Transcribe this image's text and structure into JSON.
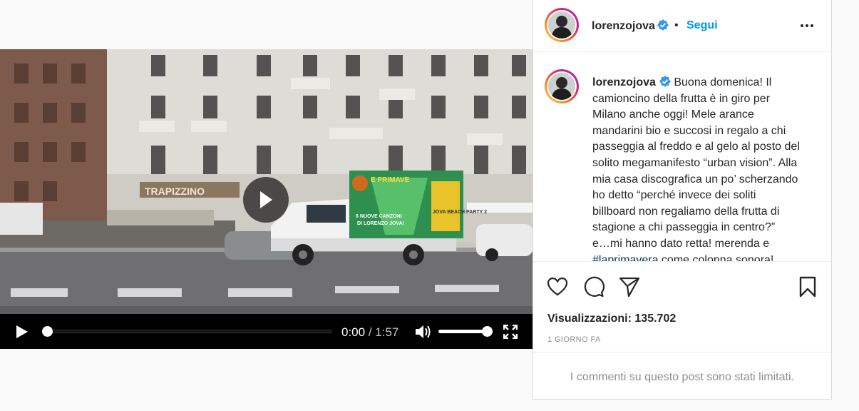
{
  "post": {
    "username": "lorenzojova",
    "follow_label": "Segui",
    "separator": "•",
    "caption_lines": [
      "Buona domenica! Il",
      "camioncino della frutta è in giro per",
      "Milano anche oggi! Mele arance",
      "mandarini bio e succosi in regalo a chi",
      "passeggia al freddo e al gelo al posto del",
      "solito megamanifesto “urban vision”. Alla",
      "mia casa discografica un po’ scherzando",
      "ho detto “perché invece dei soliti",
      "billboard non regaliamo della frutta di",
      "stagione a chi passeggia in centro?”",
      "e…mi hanno dato retta! merenda e"
    ],
    "caption_hashtag": "#laprimavera",
    "caption_tail": " come colonna sonora!",
    "views_text": "Visualizzazioni: 135.702",
    "date_text": "1 GIORNO FA",
    "comments_limited": "I commenti su questo post sono stati limitati."
  },
  "video": {
    "time_current": "0:00",
    "time_sep": " / ",
    "time_duration": "1:57",
    "progress": 0,
    "volume": 1,
    "scene": {
      "shop_sign": "TRAPIZZINO",
      "truck_text_1": "E PRIMAVE",
      "truck_text_2": "6 NUOVE CANZONI",
      "truck_text_3": "DI LORENZO JOVA!",
      "truck_text_4": "JOVA BEACH PARTY 2"
    }
  },
  "icons": {
    "heart": "heart-icon",
    "comment": "comment-icon",
    "share": "share-icon",
    "save": "bookmark-icon",
    "more": "more-icon",
    "verified": "verified-badge-icon",
    "play": "play-icon",
    "volume": "volume-icon",
    "fullscreen": "fullscreen-icon"
  },
  "colors": {
    "accent": "#0095f6",
    "verified": "#3897f0",
    "hashtag": "#00376b",
    "muted": "#8e8e8e"
  }
}
